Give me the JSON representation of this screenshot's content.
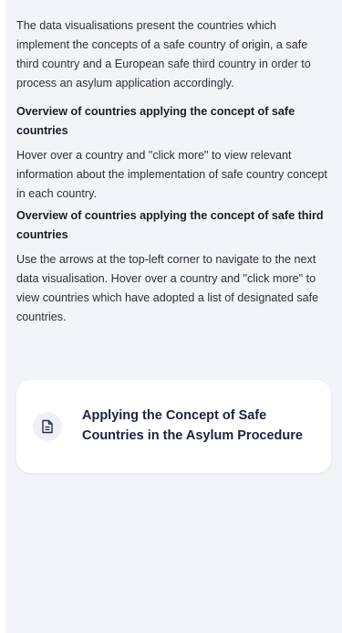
{
  "intro": "The data visualisations present the countries which implement the concepts of a safe country of origin, a safe third country and a European safe third country in order to process an asylum application accordingly.",
  "section1": {
    "heading": "Overview of countries applying the concept of safe countries",
    "body": "Hover over a country and \"click more\" to view relevant information about the implementation of safe country concept in each country."
  },
  "section2": {
    "heading": "Overview of countries applying the concept of safe third countries",
    "body": "Use the arrows at the top-left corner to navigate to the next data visualisation. Hover over a country and \"click more\" to view countries which have adopted a list of designated safe countries."
  },
  "card": {
    "icon": "document-icon",
    "title": "Applying the Concept of Safe Countries in the Asylum Procedure"
  }
}
